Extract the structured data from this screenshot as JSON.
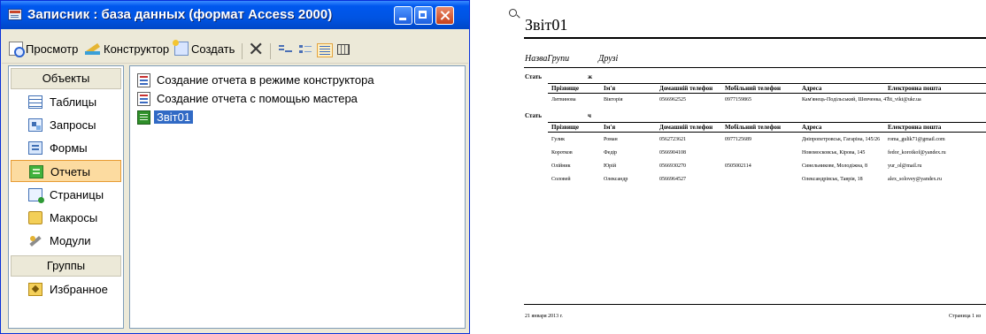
{
  "window": {
    "title": "Записник : база данных (формат Access 2000)",
    "controls": {
      "minimize": "minimize",
      "maximize": "maximize",
      "close": "close"
    }
  },
  "toolbar": {
    "preview_label": "Просмотр",
    "design_label": "Конструктор",
    "new_label": "Создать"
  },
  "objects_bar": {
    "header": "Объекты",
    "items": [
      {
        "label": "Таблицы",
        "icon": "table-icon"
      },
      {
        "label": "Запросы",
        "icon": "query-icon"
      },
      {
        "label": "Формы",
        "icon": "form-icon"
      },
      {
        "label": "Отчеты",
        "icon": "report-icon",
        "selected": true
      },
      {
        "label": "Страницы",
        "icon": "page-icon"
      },
      {
        "label": "Макросы",
        "icon": "macro-icon"
      },
      {
        "label": "Модули",
        "icon": "module-icon"
      }
    ],
    "groups_header": "Группы",
    "groups": [
      {
        "label": "Избранное",
        "icon": "favorites-icon"
      }
    ]
  },
  "list": {
    "items": [
      {
        "label": "Создание отчета в режиме конструктора",
        "icon": "design-wizard-icon"
      },
      {
        "label": "Создание отчета с помощью мастера",
        "icon": "report-wizard-icon"
      },
      {
        "label": "Звіт01",
        "icon": "report-icon",
        "selected": true
      }
    ]
  },
  "report": {
    "title": "Звіт01",
    "header_left": "НазваГрупи",
    "header_right": "Друзі",
    "group_label": "Стать",
    "columns": [
      "Прізвище",
      "Ім'я",
      "Домашній телефон",
      "Мобільний телефон",
      "Адреса",
      "Електронна пошта"
    ],
    "groups": [
      {
        "value": "ж",
        "rows": [
          [
            "Литвинова",
            "Вікторія",
            "0566962525",
            "0977159865",
            "Кам'янець-Подільський, Шевченка, 47",
            "lit_vikt@ukr.ua"
          ]
        ]
      },
      {
        "value": "ч",
        "rows": [
          [
            "Гулик",
            "Роман",
            "0562723621",
            "0977125689",
            "Дніпропетровськ, Гагаріна, 145/26",
            "roma_gulik71@gmail.com"
          ],
          [
            "Коротков",
            "Федір",
            "0566904108",
            "",
            "Новомосковськ, Кірова, 145",
            "fedor_korotkof@yandex.ru"
          ],
          [
            "Олійник",
            "Юрій",
            "0566930270",
            "0505002114",
            "Синельникове, Молодіжна, 8",
            "yur_ol@mail.ru"
          ],
          [
            "Соловей",
            "Олександр",
            "0566964527",
            "",
            "Олександрівськ, Таврія, 18",
            "alex_solovey@yandex.ru"
          ]
        ]
      }
    ],
    "footer_date": "21 января 2013 г.",
    "footer_page": "Страница 1 из"
  }
}
